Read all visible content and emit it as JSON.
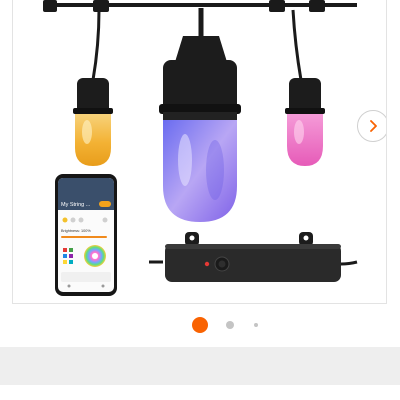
{
  "gallery": {
    "app_screen": {
      "title": "My String ...",
      "brightness_label": "Brightness: 100%"
    },
    "next_icon": "chevron-right-icon",
    "dots": {
      "count": 3,
      "active_index": 0
    }
  },
  "colors": {
    "accent": "#f96302",
    "dot_inactive": "#c4c4c4",
    "bulb_amber": "#f3b234",
    "bulb_violet": "#8f7ff2",
    "bulb_pink": "#f07ac8",
    "controller": "#2a2a2a",
    "controller_led": "#e53935",
    "bottom_strip": "#eeeeee"
  }
}
